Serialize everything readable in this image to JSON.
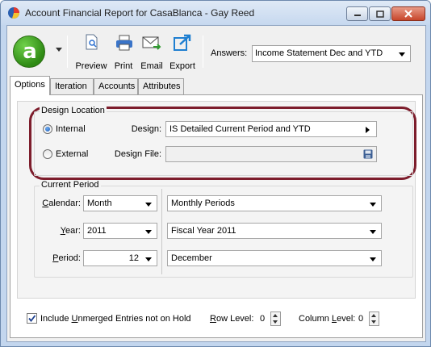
{
  "window": {
    "title": "Account Financial Report for CasaBlanca - Gay Reed"
  },
  "toolbar": {
    "logo_letter": "a",
    "preview_label": "Preview",
    "print_label": "Print",
    "email_label": "Email",
    "export_label": "Export",
    "answers_label": "Answers:",
    "answers_value": "Income Statement Dec and YTD"
  },
  "tabs": [
    {
      "label": "Options"
    },
    {
      "label": "Iteration"
    },
    {
      "label": "Accounts"
    },
    {
      "label": "Attributes"
    }
  ],
  "design_location": {
    "title": "Design Location",
    "internal_label": "Internal",
    "external_label": "External",
    "selected": "Internal",
    "design_label": "Design:",
    "design_value": "IS Detailed Current Period and YTD",
    "design_file_label": "Design File:",
    "design_file_value": ""
  },
  "current_period": {
    "title": "Current Period",
    "calendar_label": "Calendar:",
    "calendar_value": "Month",
    "calendar_desc": "Monthly Periods",
    "year_label": "Year:",
    "year_value": "2011",
    "year_desc": "Fiscal Year 2011",
    "period_label": "Period:",
    "period_value": "12",
    "period_desc": "December"
  },
  "options": {
    "include_unmerged_label": "Include Unmerged Entries not on Hold",
    "include_unmerged_checked": true,
    "row_level_label": "Row Level:",
    "row_level_value": "0",
    "column_level_label": "Column Level:",
    "column_level_value": "0"
  },
  "colors": {
    "highlight": "#7d1d2c",
    "logo_green": "#2e8a14"
  }
}
